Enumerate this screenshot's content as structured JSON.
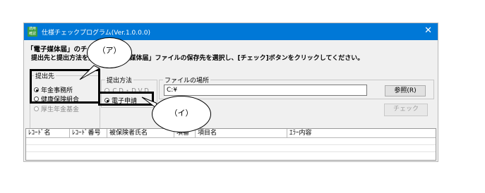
{
  "window": {
    "app_icon_label": "適用確認",
    "title": "仕様チェックプログラム(Ver.1.0.0.0)",
    "close_glyph": "✕"
  },
  "heading": "「電子媒体届」のチェック",
  "instruction": "提出先と提出方法を選択し、「電子媒体届」ファイルの保存先を選択し、[チェック]ボタンをクリックしてください。",
  "destination_group": {
    "label": "提出先",
    "options": [
      {
        "label": "年金事務所",
        "selected": true,
        "enabled": true
      },
      {
        "label": "健康保険組合",
        "selected": false,
        "enabled": true
      },
      {
        "label": "厚生年金基金",
        "selected": false,
        "enabled": false
      }
    ]
  },
  "method_group": {
    "label": "提出方法",
    "options": [
      {
        "label": "ＣＤ・ＤＶＤ",
        "selected": false,
        "enabled": false
      },
      {
        "label": "電子申請",
        "selected": true,
        "enabled": true
      }
    ]
  },
  "file_group": {
    "label": "ファイルの場所",
    "path_value": "C:¥",
    "browse_label": "参照(R)"
  },
  "check_button_label": "チェック",
  "table": {
    "columns": [
      "ﾚｺｰﾄﾞ名",
      "ﾚｺｰﾄﾞ番号",
      "被保険者氏名",
      "項番",
      "項目名",
      "ｴﾗｰ内容"
    ]
  },
  "callouts": {
    "a": "（ア）",
    "i": "（イ）"
  }
}
